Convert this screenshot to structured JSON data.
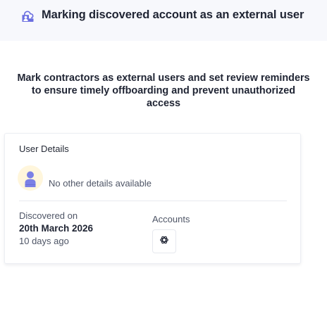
{
  "header": {
    "icon": "cloud-user-icon",
    "title": "Marking discovered account as an external user"
  },
  "description": "Mark contractors as external users and set review reminders to ensure timely offboarding and prevent unauthorized access",
  "card": {
    "title": "User Details",
    "avatar_icon": "user-avatar-icon",
    "no_details": "No other details available",
    "discovered": {
      "label": "Discovered on",
      "date": "20th March 2026",
      "relative": "10 days ago"
    },
    "accounts": {
      "label": "Accounts",
      "items": [
        {
          "icon": "openai-icon"
        }
      ]
    }
  },
  "colors": {
    "header_bg": "#f7f8fc",
    "accent": "#6b6fe0",
    "avatar_bg": "#fff6dc",
    "text_primary": "#1f2433",
    "text_secondary": "#4e5566"
  }
}
